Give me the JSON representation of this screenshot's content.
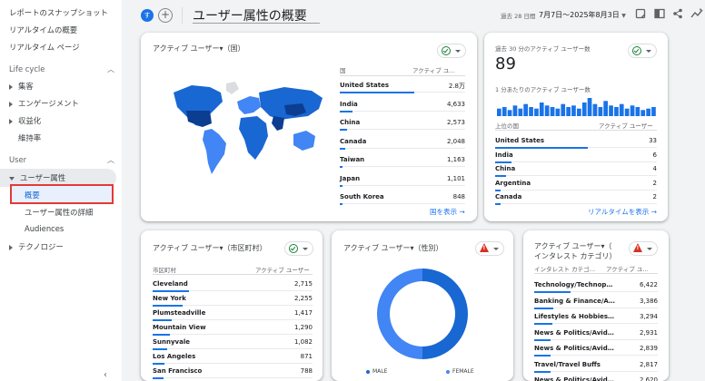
{
  "sidebar": {
    "top_items": [
      "レポートのスナップショット",
      "リアルタイムの概要",
      "リアルタイム ページ"
    ],
    "lifecycle": {
      "label": "Life cycle",
      "items": [
        "集客",
        "エンゲージメント",
        "収益化",
        "維持率"
      ]
    },
    "user": {
      "label": "User",
      "group": "ユーザー属性",
      "subitems": [
        "概要",
        "ユーザー属性の詳細",
        "Audiences"
      ],
      "tech": "テクノロジー"
    }
  },
  "header": {
    "avatar": "す",
    "title": "ユーザー属性の概要",
    "date_label": "過去 28 日間",
    "date_range": "7月7日～2025年8月3日",
    "icons": [
      "report-icon",
      "compare-icon",
      "share-icon",
      "insights-icon"
    ]
  },
  "country_card": {
    "title": "アクティブ ユーザー▾（国）",
    "col_label": "国",
    "col_value": "アクティブ ユ…",
    "rows": [
      {
        "name": "United States",
        "value": "2.8万"
      },
      {
        "name": "India",
        "value": "4,633"
      },
      {
        "name": "China",
        "value": "2,573"
      },
      {
        "name": "Canada",
        "value": "2,048"
      },
      {
        "name": "Taiwan",
        "value": "1,163"
      },
      {
        "name": "Japan",
        "value": "1,101"
      },
      {
        "name": "South Korea",
        "value": "848"
      }
    ],
    "bar_fractions": [
      1.0,
      0.165,
      0.092,
      0.073,
      0.042,
      0.039,
      0.03
    ],
    "link": "国を表示"
  },
  "realtime_card": {
    "title": "過去 30 分のアクティブ ユーザー数",
    "big_value": "89",
    "per_minute_label": "1 分あたりのアクティブ ユーザー数",
    "minute_bars": [
      5,
      6,
      4,
      7,
      5,
      8,
      6,
      5,
      9,
      7,
      6,
      5,
      8,
      6,
      7,
      5,
      9,
      12,
      8,
      6,
      10,
      7,
      6,
      8,
      5,
      7,
      6,
      4,
      5,
      6
    ],
    "col_label": "上位の国",
    "col_value": "アクティブ ユーザー",
    "rows": [
      {
        "name": "United States",
        "value": "33"
      },
      {
        "name": "India",
        "value": "6"
      },
      {
        "name": "China",
        "value": "4"
      },
      {
        "name": "Argentina",
        "value": "2"
      },
      {
        "name": "Canada",
        "value": "2"
      }
    ],
    "bar_fractions": [
      1.0,
      0.18,
      0.12,
      0.06,
      0.06
    ],
    "link": "リアルタイムを表示"
  },
  "city_card": {
    "title": "アクティブ ユーザー▾（市区町村）",
    "col_label": "市区町村",
    "col_value": "アクティブ ユーザー",
    "rows": [
      {
        "name": "Cleveland",
        "value": "2,715"
      },
      {
        "name": "New York",
        "value": "2,255"
      },
      {
        "name": "Plumsteadville",
        "value": "1,417"
      },
      {
        "name": "Mountain View",
        "value": "1,290"
      },
      {
        "name": "Sunnyvale",
        "value": "1,082"
      },
      {
        "name": "Los Angeles",
        "value": "871"
      },
      {
        "name": "San Francisco",
        "value": "788"
      }
    ],
    "bar_fractions": [
      1.0,
      0.83,
      0.52,
      0.47,
      0.4,
      0.32,
      0.29
    ]
  },
  "gender_card": {
    "title": "アクティブ ユーザー▾（性別）",
    "legend": [
      {
        "label": "MALE",
        "color": "#1967d2"
      },
      {
        "label": "FEMALE",
        "color": "#4285f4"
      }
    ],
    "slices": [
      0.5,
      0.5
    ]
  },
  "interest_card": {
    "title": "アクティブ ユーザー▾（",
    "title2": "インタレスト カテゴリ）",
    "col_label": "インタレスト カテゴ…",
    "col_value": "アクティブ ユ…",
    "rows": [
      {
        "name": "Technology/Technop…",
        "value": "6,422"
      },
      {
        "name": "Banking & Finance/A…",
        "value": "3,386"
      },
      {
        "name": "Lifestyles & Hobbies…",
        "value": "3,294"
      },
      {
        "name": "News & Politics/Avid…",
        "value": "2,931"
      },
      {
        "name": "News & Politics/Avid…",
        "value": "2,839"
      },
      {
        "name": "Travel/Travel Buffs",
        "value": "2,817"
      },
      {
        "name": "News & Politics/Avid…",
        "value": "2,620"
      }
    ],
    "bar_fractions": [
      1.0,
      0.53,
      0.51,
      0.46,
      0.44,
      0.44,
      0.41
    ]
  }
}
